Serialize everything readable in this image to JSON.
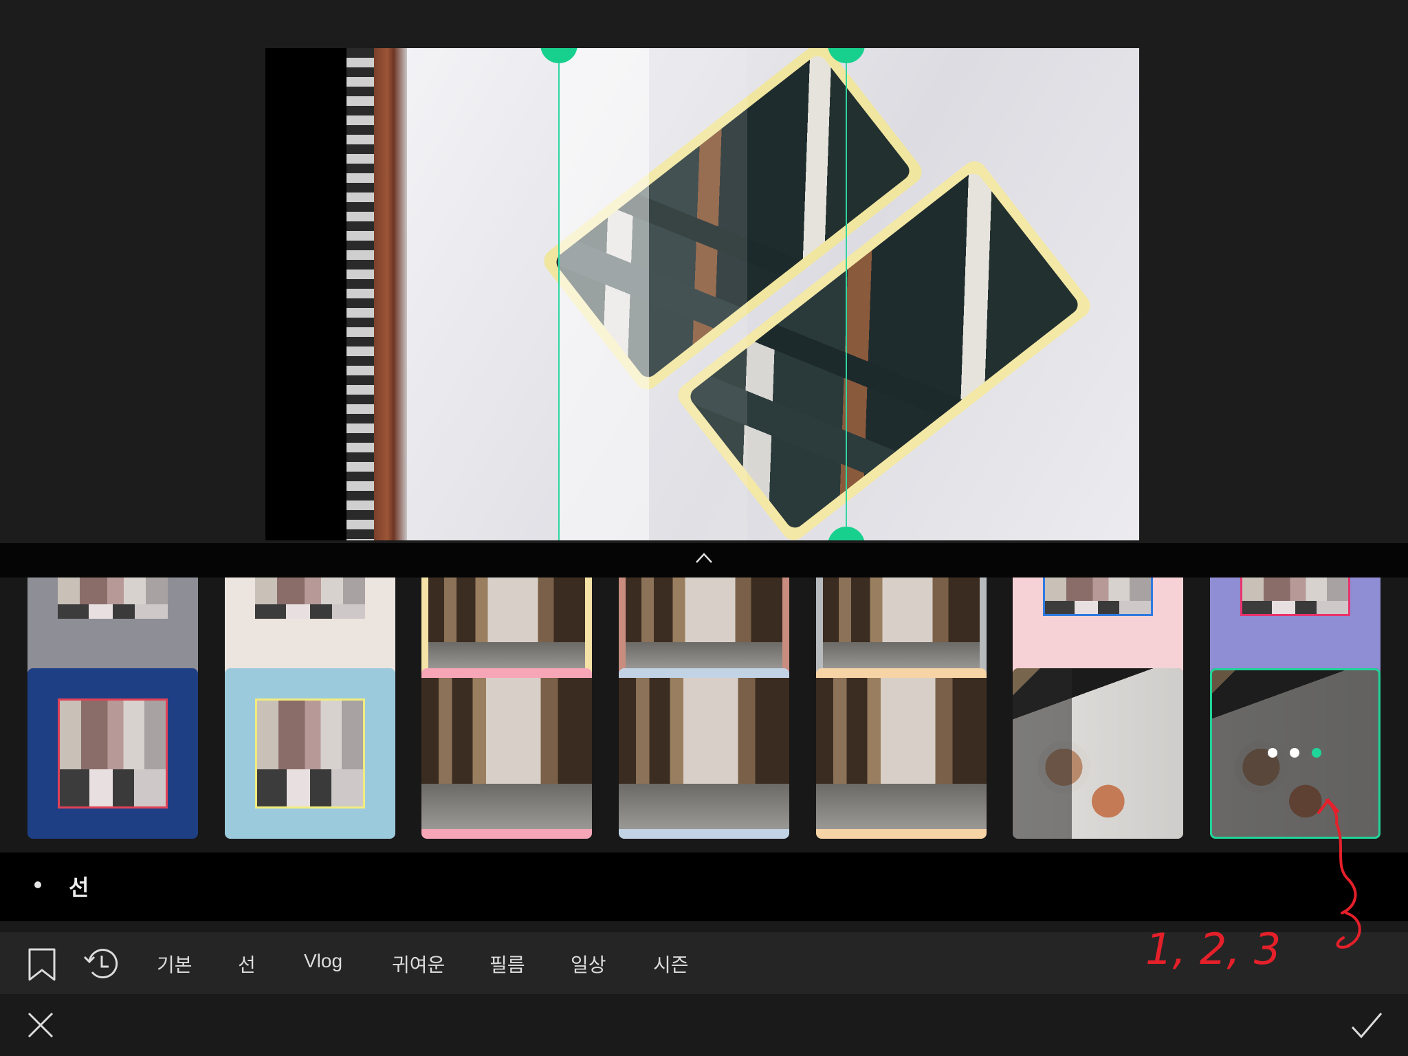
{
  "colors": {
    "accent": "#1fd59a",
    "annotation": "#e5202a",
    "background": "#1a1a1a"
  },
  "preview": {
    "guides": 2
  },
  "thumbnails": {
    "row1": [
      {
        "frame_color": "#8e8e96"
      },
      {
        "frame_color": "#ece4df"
      },
      {
        "frame_color": "#f4e2a6"
      },
      {
        "frame_color": "#c98d80"
      },
      {
        "frame_color": "#b8bbbd"
      },
      {
        "frame_color": "#f6d2d6"
      },
      {
        "frame_color": "#8f8dd3"
      }
    ],
    "row2": [
      {
        "frame_color": "#1e3f84",
        "inner_border": "#e04256"
      },
      {
        "frame_color": "#9ccadd",
        "inner_border": "#f1ec7e"
      },
      {
        "bar_color": "#f7a6b8"
      },
      {
        "bar_color": "#c2d3e6"
      },
      {
        "bar_color": "#f7d4a6"
      },
      {
        "style": "split-brightness"
      },
      {
        "style": "selected",
        "selected": true
      }
    ],
    "selected_dots": [
      "#ffffff",
      "#ffffff",
      "#1fd59a"
    ]
  },
  "section": {
    "title": "선"
  },
  "tabs": [
    "기본",
    "선",
    "Vlog",
    "귀여운",
    "필름",
    "일상",
    "시즌"
  ],
  "icons": {
    "bookmark": "bookmark-icon",
    "history": "history-icon",
    "close": "close-icon",
    "confirm": "check-icon",
    "collapse": "chevron-up-icon"
  },
  "annotation": {
    "text": "1, 2, 3"
  }
}
